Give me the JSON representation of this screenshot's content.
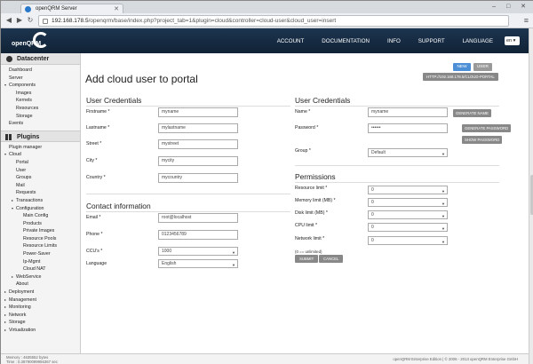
{
  "browser": {
    "tab_title": "openQRM Server",
    "url_host": "192.168.178.5",
    "url_path": "/openqrm/base/index.php?project_tab=1&plugin=cloud&controller=cloud-user&cloud_user=insert"
  },
  "topnav": {
    "logo_text": "openQRM",
    "links": [
      "ACCOUNT",
      "DOCUMENTATION",
      "INFO",
      "SUPPORT",
      "LANGUAGE"
    ],
    "language": "en"
  },
  "sidebar": {
    "datacenter_title": "Datacenter",
    "datacenter_items": [
      {
        "label": "Dashboard",
        "indent": 0,
        "arrow": ""
      },
      {
        "label": "Server",
        "indent": 0,
        "arrow": ""
      },
      {
        "label": "Components",
        "indent": 0,
        "arrow": "▾"
      },
      {
        "label": "Images",
        "indent": 2,
        "arrow": ""
      },
      {
        "label": "Kernels",
        "indent": 2,
        "arrow": ""
      },
      {
        "label": "Resources",
        "indent": 2,
        "arrow": ""
      },
      {
        "label": "Storage",
        "indent": 2,
        "arrow": ""
      },
      {
        "label": "Events",
        "indent": 0,
        "arrow": ""
      }
    ],
    "plugins_title": "Plugins",
    "plugin_items": [
      {
        "label": "Plugin manager",
        "indent": 0,
        "arrow": ""
      },
      {
        "label": "Cloud",
        "indent": 0,
        "arrow": "▾"
      },
      {
        "label": "Portal",
        "indent": 2,
        "arrow": ""
      },
      {
        "label": "User",
        "indent": 2,
        "arrow": ""
      },
      {
        "label": "Groups",
        "indent": 2,
        "arrow": ""
      },
      {
        "label": "Mail",
        "indent": 2,
        "arrow": ""
      },
      {
        "label": "Requests",
        "indent": 2,
        "arrow": ""
      },
      {
        "label": "Transactions",
        "indent": 2,
        "arrow": "▸"
      },
      {
        "label": "Configuration",
        "indent": 2,
        "arrow": "▾"
      },
      {
        "label": "Main Config",
        "indent": 4,
        "arrow": ""
      },
      {
        "label": "Products",
        "indent": 4,
        "arrow": ""
      },
      {
        "label": "Private Images",
        "indent": 4,
        "arrow": ""
      },
      {
        "label": "Resource Pools",
        "indent": 4,
        "arrow": ""
      },
      {
        "label": "Resource Limits",
        "indent": 4,
        "arrow": ""
      },
      {
        "label": "Power-Saver",
        "indent": 4,
        "arrow": ""
      },
      {
        "label": "Ip-Mgmt",
        "indent": 4,
        "arrow": ""
      },
      {
        "label": "Cloud NAT",
        "indent": 4,
        "arrow": ""
      },
      {
        "label": "WebService",
        "indent": 2,
        "arrow": "▸"
      },
      {
        "label": "About",
        "indent": 2,
        "arrow": ""
      },
      {
        "label": "Deployment",
        "indent": 0,
        "arrow": "▸"
      },
      {
        "label": "Management",
        "indent": 0,
        "arrow": "▸"
      },
      {
        "label": "Monitoring",
        "indent": 0,
        "arrow": "▸"
      },
      {
        "label": "Network",
        "indent": 0,
        "arrow": "▸"
      },
      {
        "label": "Storage",
        "indent": 0,
        "arrow": "▸"
      },
      {
        "label": "Virtualization",
        "indent": 0,
        "arrow": "▸"
      }
    ]
  },
  "main": {
    "buttons": {
      "new": "NEW",
      "user": "USER",
      "portal": "HTTP://192.168.178.5/CLOUD-PORTAL"
    },
    "title": "Add cloud user to portal",
    "left_section_title": "User Credentials",
    "credentials_fields": [
      {
        "label": "Firstname *",
        "value": "myname"
      },
      {
        "label": "Lastname *",
        "value": "mylastname"
      },
      {
        "label": "Street *",
        "value": "mystreet"
      },
      {
        "label": "City *",
        "value": "mycity"
      },
      {
        "label": "Country *",
        "value": "mycountry"
      }
    ],
    "contact_title": "Contact information",
    "contact_fields": [
      {
        "label": "Email *",
        "value": "root@localhost"
      },
      {
        "label": "Phone *",
        "value": "0123456789"
      }
    ],
    "ccus": {
      "label": "CCU's *",
      "value": "1000"
    },
    "language": {
      "label": "Language",
      "value": "English"
    },
    "right_section_title": "User Credentials",
    "name": {
      "label": "Name *",
      "value": "myname",
      "button": "GENERATE NAME"
    },
    "password": {
      "label": "Password *",
      "value": "••••••",
      "gen_button": "GENERATE PASSWORD",
      "show_button": "SHOW PASSWORD"
    },
    "group": {
      "label": "Group *",
      "value": "Default"
    },
    "permissions_title": "Permissions",
    "permissions": [
      {
        "label": "Resource limit *",
        "value": "0"
      },
      {
        "label": "Memory limit (MB) *",
        "value": "0"
      },
      {
        "label": "Disk limit (MB) *",
        "value": "0"
      },
      {
        "label": "CPU limit *",
        "value": "0"
      },
      {
        "label": "Network limit *",
        "value": "0"
      }
    ],
    "unlimited_note": "(0 == unlimited)",
    "submit": "SUBMIT",
    "cancel": "CANCEL"
  },
  "footer": {
    "memory": "Memory : 4635552 bytes",
    "time": "Time : 0.38790099956367 sec",
    "copyright": "openQRM Enterprise Edition | © 2006 - 2013 openQRM Enterprise GmbH"
  }
}
